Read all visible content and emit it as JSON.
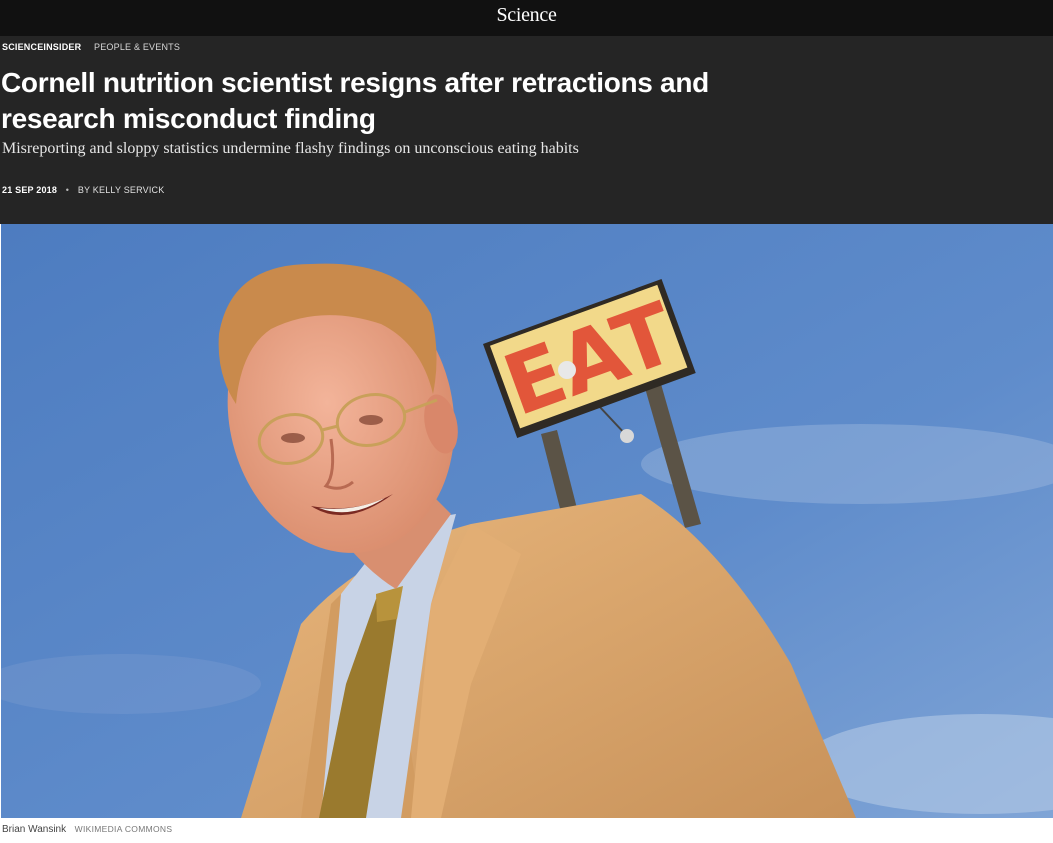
{
  "nav": {
    "logo": "Science"
  },
  "breadcrumb": {
    "section": "SCIENCEINSIDER",
    "category": "PEOPLE & EVENTS"
  },
  "article": {
    "headline": "Cornell nutrition scientist resigns after retractions and research misconduct finding",
    "dek": "Misreporting and sloppy statistics undermine flashy findings on unconscious eating habits",
    "date": "21 SEP 2018",
    "separator": "•",
    "byline": "BY KELLY SERVICK"
  },
  "photo": {
    "sign_text": "EAT",
    "caption": "Brian Wansink",
    "credit": "WIKIMEDIA COMMONS"
  },
  "colors": {
    "topbar": "#111111",
    "header": "#252525",
    "sky": "#5a87c6",
    "sign_face": "#f2d98a",
    "sign_letters": "#e2563a",
    "jacket": "#d9a66c"
  }
}
